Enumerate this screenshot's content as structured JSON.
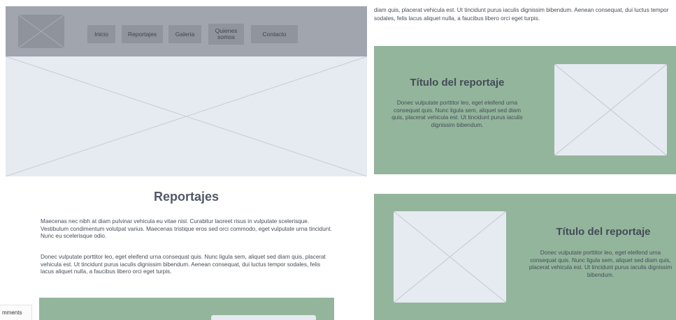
{
  "nav": {
    "items": [
      "Inicio",
      "Reportajes",
      "Galeria",
      "Quienes somos",
      "Contacto"
    ]
  },
  "main": {
    "section_title": "Reportajes",
    "paragraph1": "Maecenas nec nibh at diam pulvinar vehicula eu vitae nisl. Curabitur laoreet risus in vulputate scelerisque. Vestibulum condimentum volutpat varius. Maecenas tristique eros sed orci commodo, eget vulputate urna tincidunt. Nunc eu scelerisque odio.",
    "paragraph2": "Donec vulputate porttitor leo, eget eleifend urna consequat quis. Nunc ligula sem, aliquet sed diam quis, placerat vehicula est. Ut tincidunt purus iaculis dignissim bibendum. Aenean consequat, dui luctus tempor sodales, felis lacus aliquet nulla, a faucibus libero orci eget turpis."
  },
  "comments_tab": "mments",
  "right": {
    "intro": "diam quis, placerat vehicula est. Ut tincidunt purus iaculis dignissim bibendum. Aenean consequat, dui luctus tempor sodales, felis lacus aliquet nulla, a faucibus libero orci eget turpis.",
    "cards": [
      {
        "title": "Título del reportaje",
        "body": "Donec vulputate porttitor leo, eget eleifend urna consequat quis. Nunc ligula sem, aliquet sed diam quis, placerat vehicula est. Ut tincidunt purus iaculis dignissim bibendum."
      },
      {
        "title": "Título del reportaje",
        "body": "Donec vulputate porttitor leo, eget eleifend urna consequat quis. Nunc ligula sem, aliquet sed diam quis, placerat vehicula est. Ut tincidunt purus iaculis dignissim bibendum."
      }
    ]
  },
  "colors": {
    "header_bg": "#a0a5ae",
    "nav_button_bg": "#8f949d",
    "hero_bg": "#e6eaf1",
    "card_bg": "#93b59c",
    "placeholder_bg": "#e6eaf1"
  }
}
